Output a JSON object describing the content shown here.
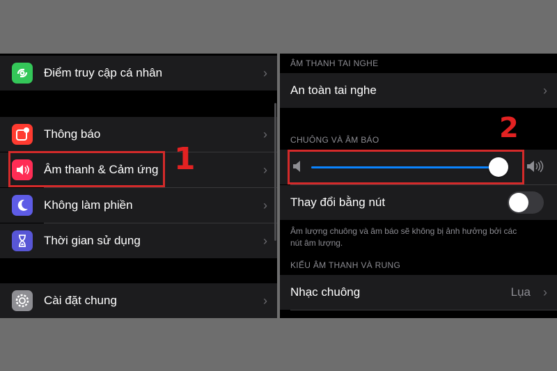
{
  "left": {
    "rows": [
      {
        "label": "Điểm truy cập cá nhân",
        "icon": "hotspot-icon",
        "color": "#34c759"
      },
      {
        "label": "Thông báo",
        "icon": "notifications-icon",
        "color": "#ff3b30"
      },
      {
        "label": "Âm thanh & Cảm ứng",
        "icon": "speaker-icon",
        "color": "#ff2d55"
      },
      {
        "label": "Không làm phiền",
        "icon": "moon-icon",
        "color": "#5e5ce6"
      },
      {
        "label": "Thời gian sử dụng",
        "icon": "hourglass-icon",
        "color": "#5856d6"
      },
      {
        "label": "Cài đặt chung",
        "icon": "gear-icon",
        "color": "#8e8e93"
      }
    ],
    "badge": "1"
  },
  "right": {
    "section_headphone": "ÂM THANH TAI NGHE",
    "headphone_safety": "An toàn tai nghe",
    "section_ringer": "CHUÔNG VÀ ÂM BÁO",
    "slider_level": 0.96,
    "toggle_label": "Thay đổi bằng nút",
    "toggle_on": false,
    "footer_line1": "Âm lượng chuông và âm báo sẽ không bị ảnh hưởng bởi các",
    "footer_line2": "nút âm lượng.",
    "section_patterns": "KIỂU ÂM THANH VÀ RUNG",
    "ringtone_label": "Nhạc chuông",
    "ringtone_value": "Lụa",
    "badge": "2"
  },
  "colors": {
    "slider_track": "#0a84ff",
    "highlight": "#d42a2a"
  }
}
